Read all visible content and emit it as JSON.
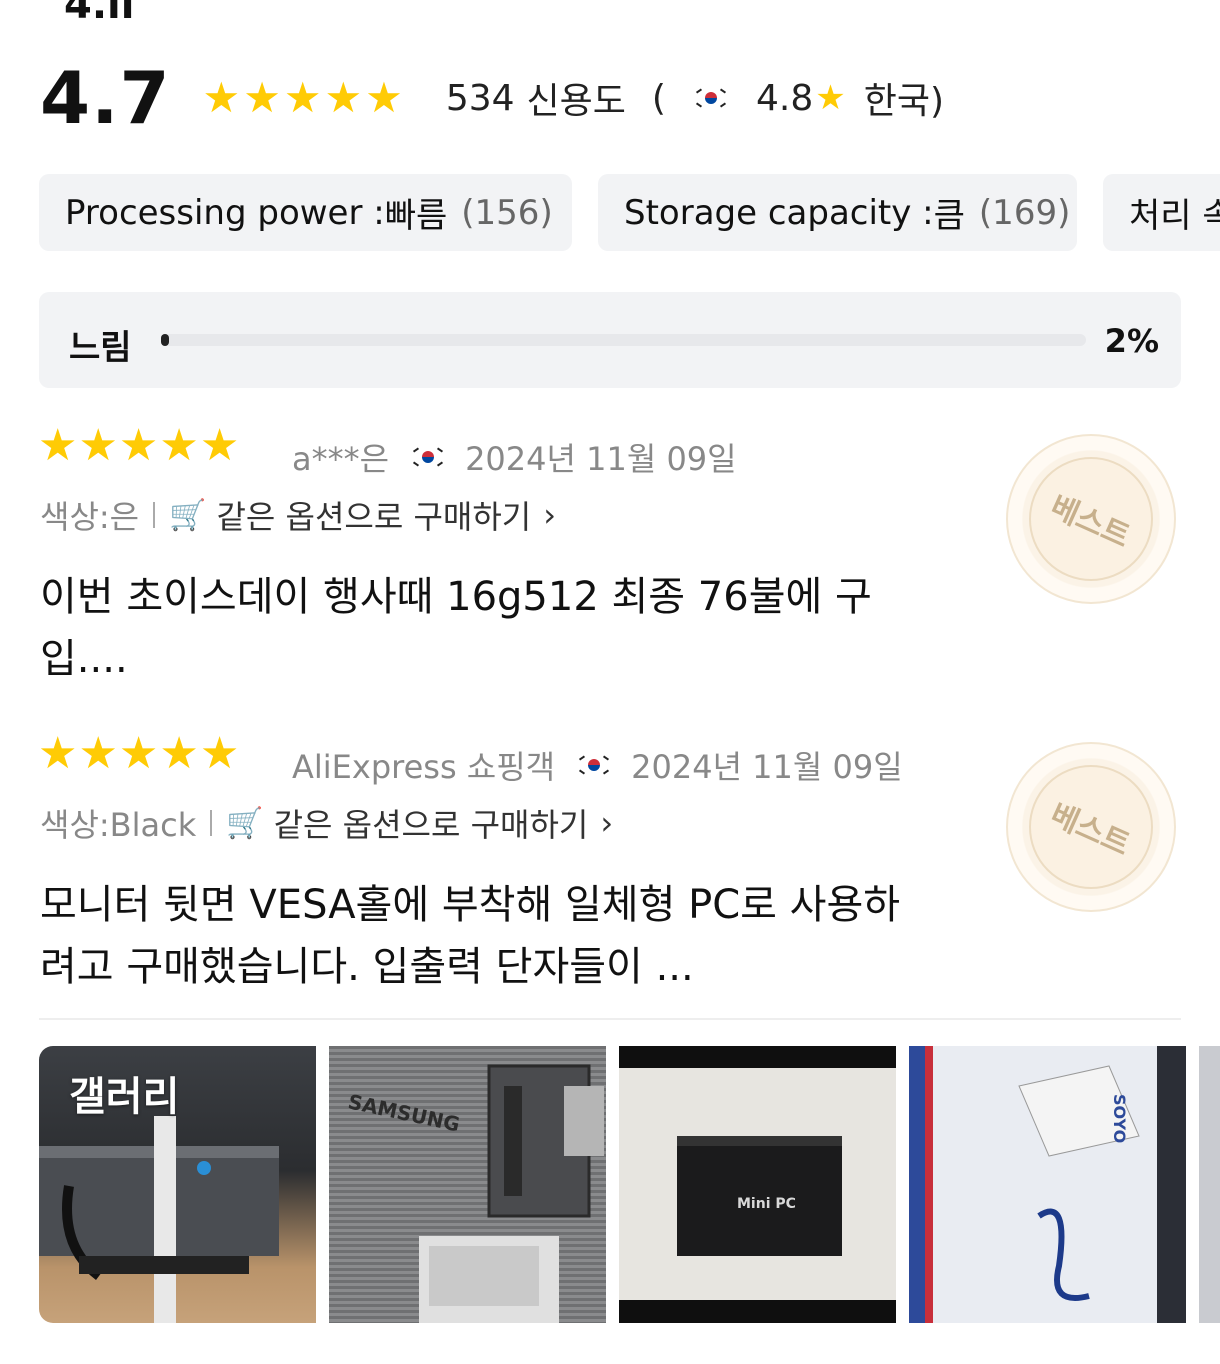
{
  "header": {
    "top_fragment": "4.ll"
  },
  "rating": {
    "average": "4.7",
    "star_count": 5,
    "review_count": "534",
    "credibility_label": "신용도",
    "open_paren": "(",
    "country_score": "4.8",
    "country_label": "한국)"
  },
  "chips": [
    {
      "key": "Processing power : ",
      "value": "빠름",
      "count": "(156)"
    },
    {
      "key": "Storage capacity : ",
      "value": "큼",
      "count": "(169)"
    },
    {
      "key": "처리 속",
      "value": "",
      "count": ""
    }
  ],
  "slow_bar": {
    "label": "느림",
    "percent_text": "2%",
    "fraction": 0.02
  },
  "reviews": [
    {
      "stars": 5,
      "author": "a***은",
      "date": "2024년 11월 09일",
      "option": "색상:은",
      "buy_label": "같은 옵션으로 구매하기",
      "text": "이번 초이스데이 행사때 16g512 최종 76불에 구입....",
      "badge": "베스트"
    },
    {
      "stars": 5,
      "author": "AliExpress 쇼핑객",
      "date": "2024년 11월 09일",
      "option": "색상:Black",
      "buy_label": "같은 옵션으로 구매하기",
      "text": "모니터 뒷면 VESA홀에 부착해 일체형 PC로 사용하려고 구매했습니다. 입출력 단자들이 ...",
      "badge": "베스트"
    }
  ],
  "gallery": {
    "label": "갤러리",
    "images": [
      {
        "name": "photo-mini-pc-on-desk",
        "caption": ""
      },
      {
        "name": "photo-monitor-back",
        "caption": "SAMSUNG"
      },
      {
        "name": "photo-mini-pc-box",
        "caption": "Mini PC"
      },
      {
        "name": "photo-packaging",
        "caption": "SOYO"
      }
    ]
  },
  "colors": {
    "star": "#ffcb05",
    "chip_bg": "#f2f3f5",
    "meta_gray": "#888888",
    "badge_text": "#c7b08c"
  }
}
